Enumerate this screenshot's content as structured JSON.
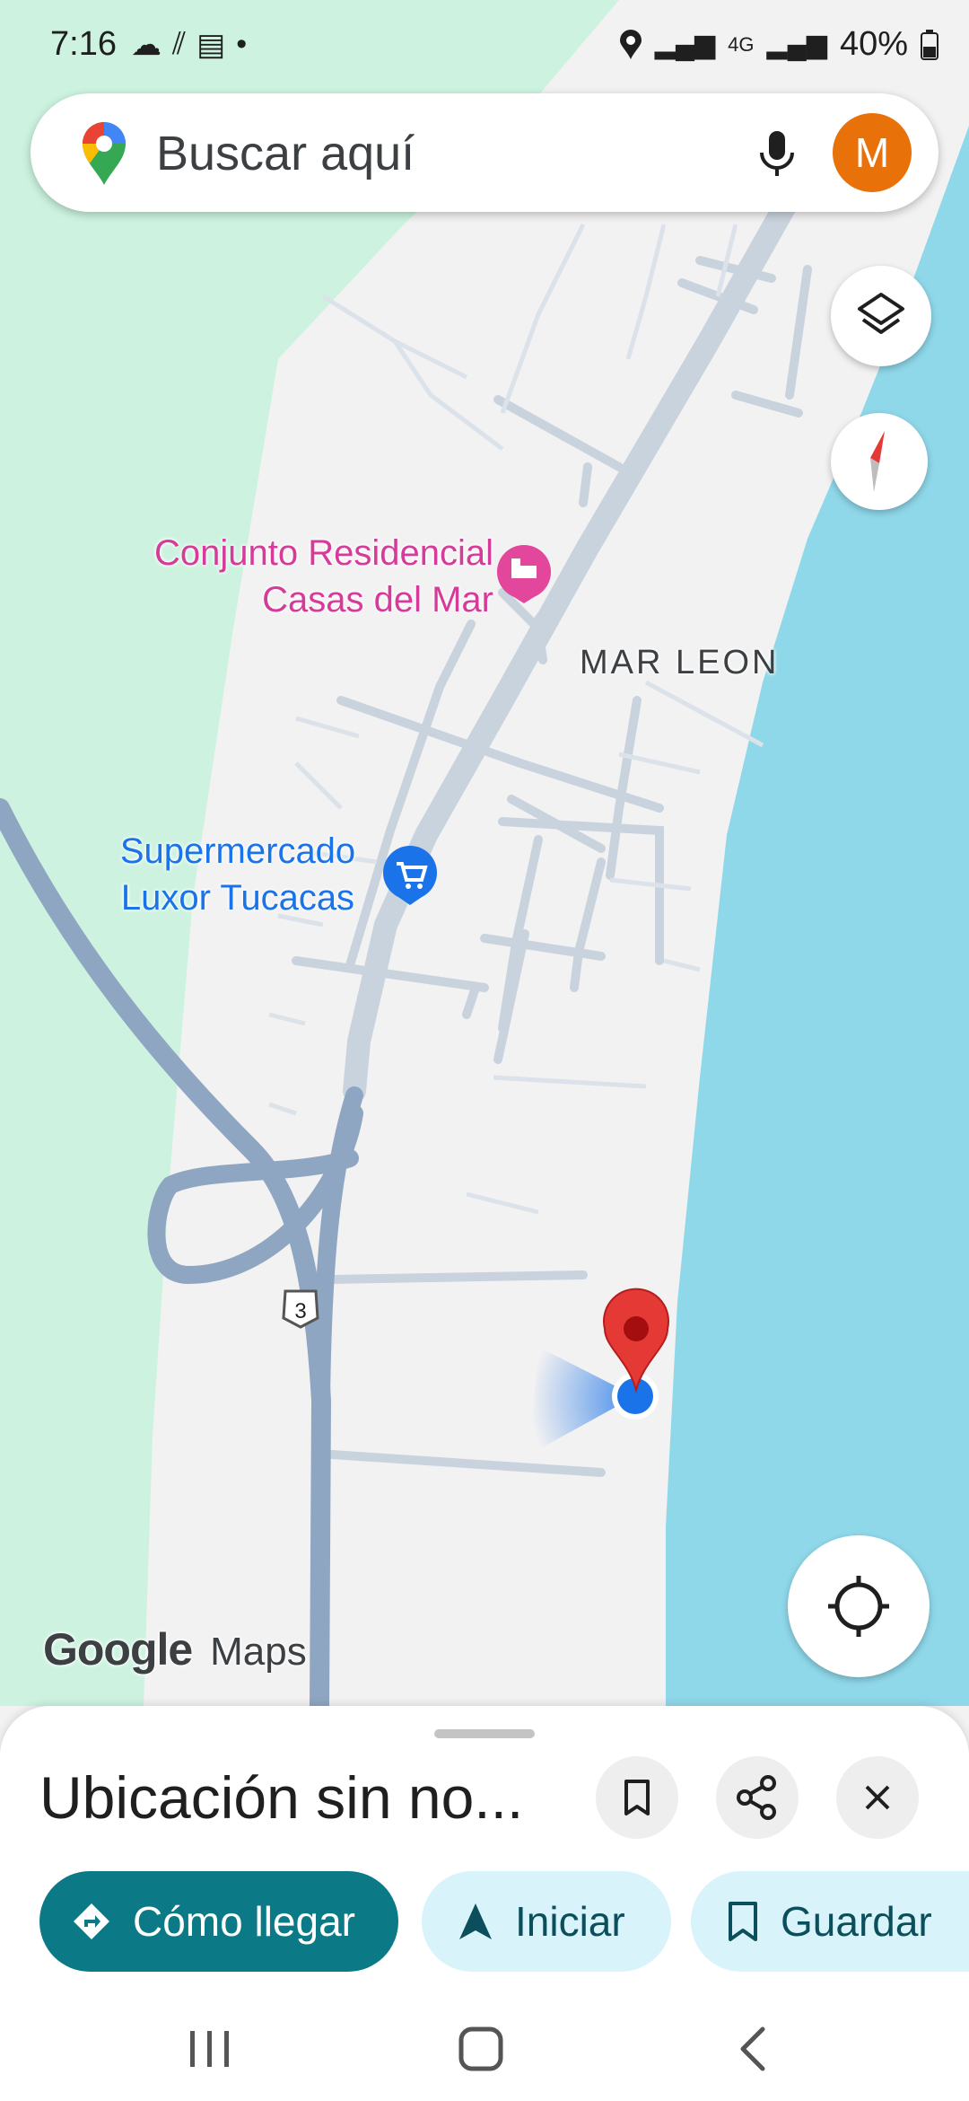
{
  "status_bar": {
    "time": "7:16",
    "battery": "40%",
    "network": "4G"
  },
  "search": {
    "placeholder": "Buscar aquí",
    "avatar_letter": "M"
  },
  "map": {
    "labels": {
      "poi_hotel_line1": "Conjunto Residencial",
      "poi_hotel_line2": "Casas del Mar",
      "neighborhood": "MAR LEON",
      "poi_market_line1": "Supermercado",
      "poi_market_line2": "Luxor Tucacas",
      "route_number": "3"
    },
    "watermark_google": "Google",
    "watermark_maps": "Maps",
    "colors": {
      "land": "#f3f2f2",
      "green": "#cdf3e0",
      "water": "#8fd8ea",
      "highway": "#8fa6c2",
      "road": "#c9d3dd",
      "hotel_pink": "#e3479b",
      "market_blue": "#1a73e8",
      "pin_red": "#e53935"
    }
  },
  "sheet": {
    "title": "Ubicación sin no...",
    "buttons": {
      "directions": "Cómo llegar",
      "start": "Iniciar",
      "save": "Guardar"
    }
  }
}
